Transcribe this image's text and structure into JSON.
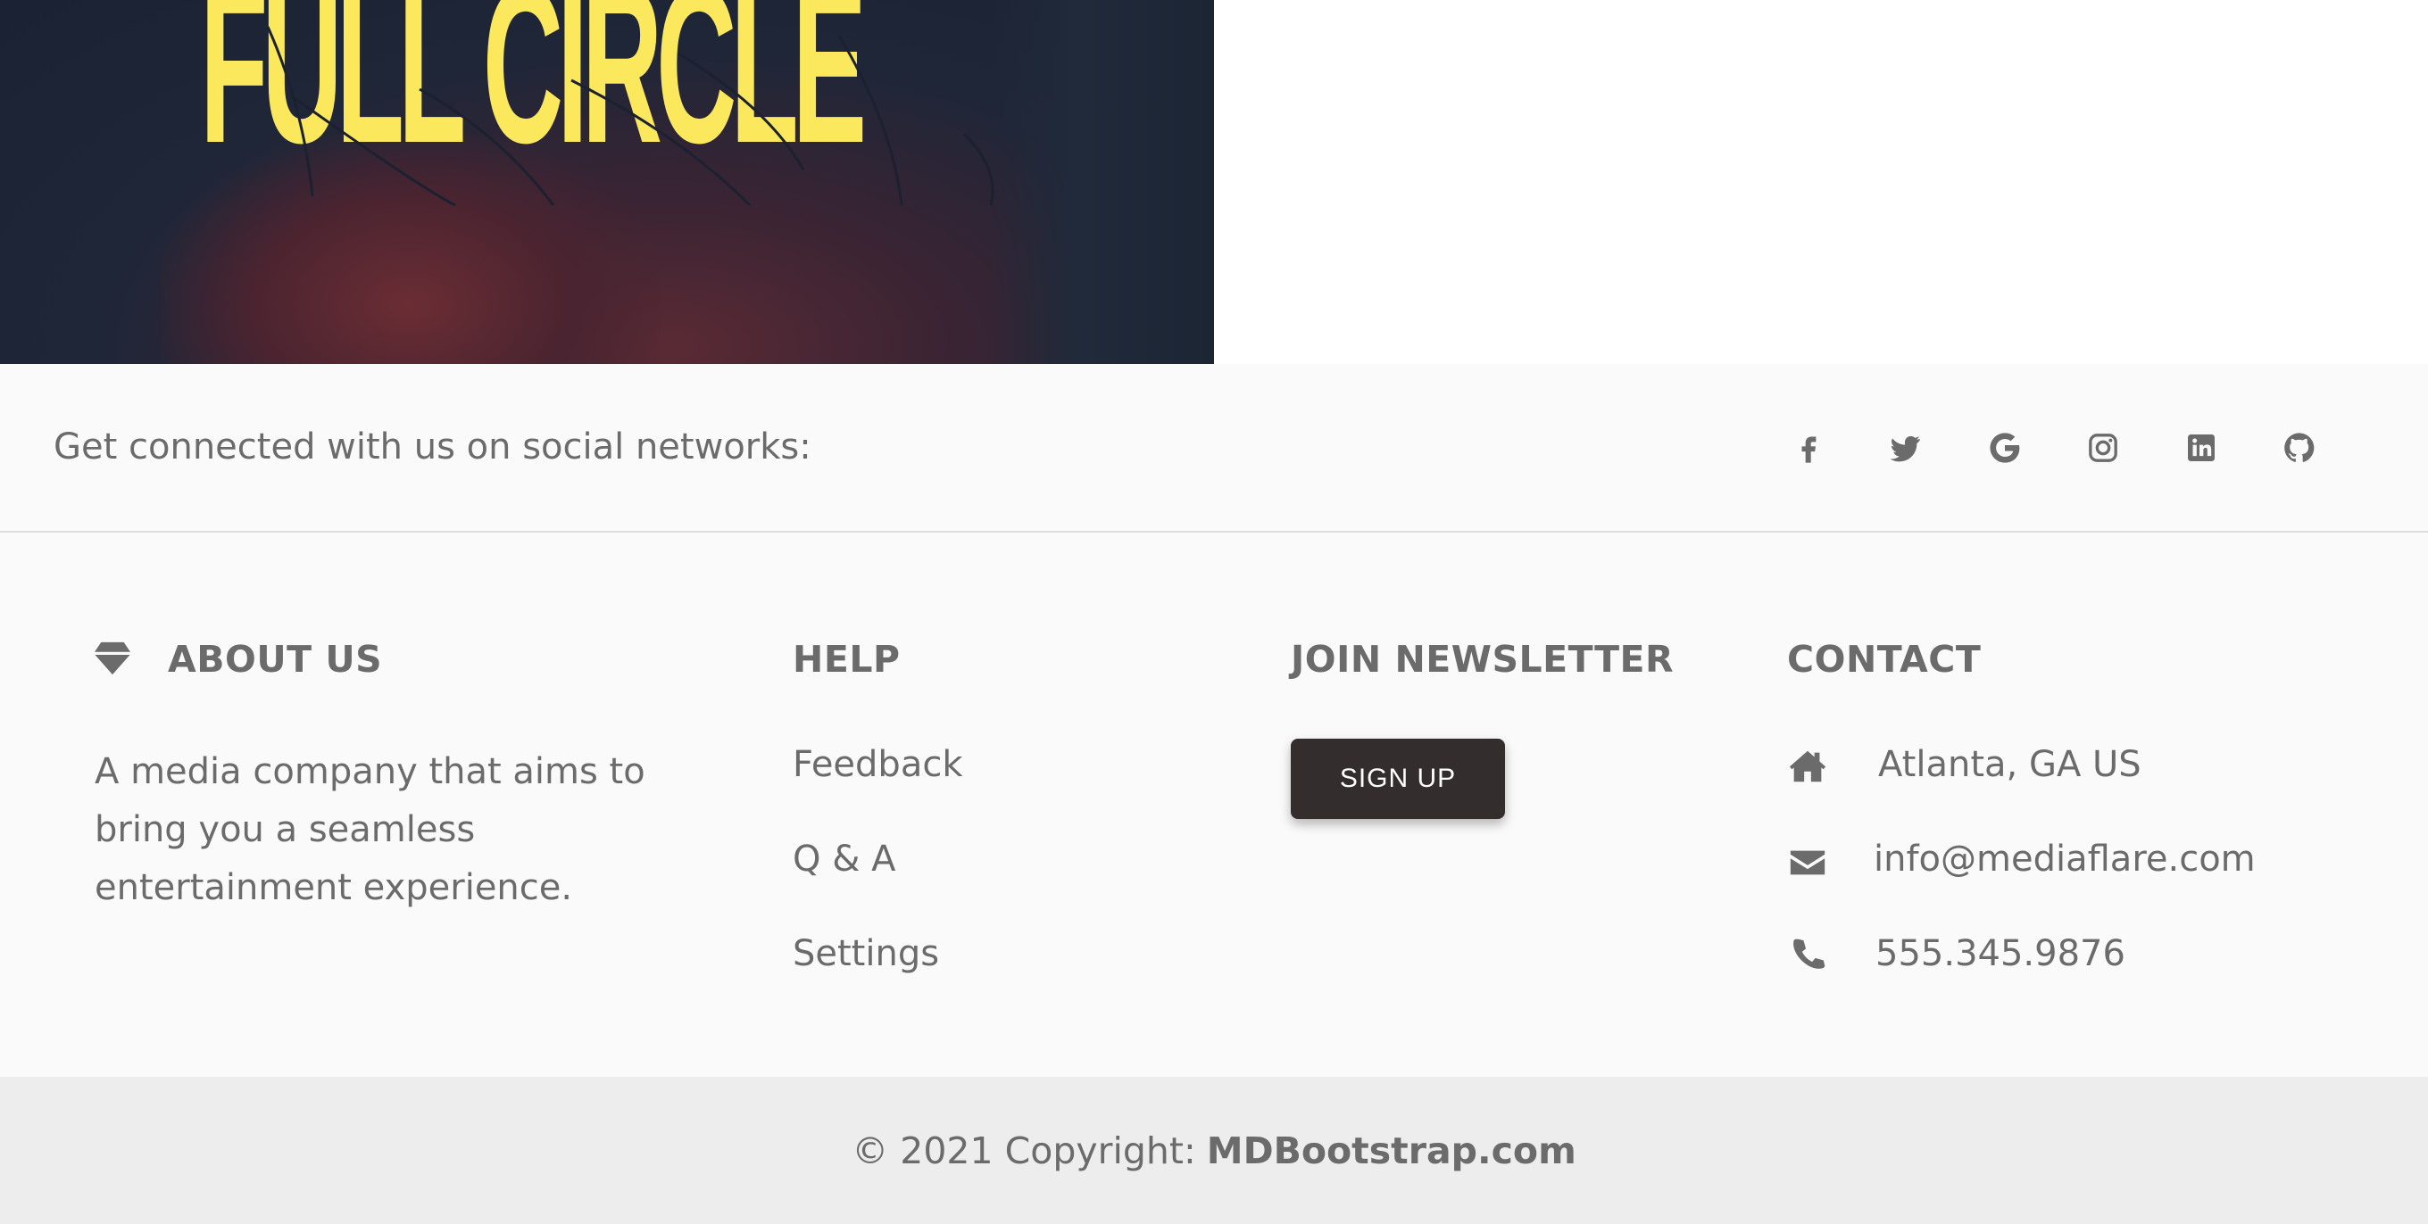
{
  "banner": {
    "title": "FULL CIRCLE",
    "title_color": "#fbe85c"
  },
  "social": {
    "text": "Get connected with us on social networks:",
    "icons": [
      "facebook-icon",
      "twitter-icon",
      "google-icon",
      "instagram-icon",
      "linkedin-icon",
      "github-icon"
    ]
  },
  "about": {
    "icon": "gem-icon",
    "title": "ABOUT US",
    "text": "A media company that aims to bring you a seamless entertainment experience."
  },
  "help": {
    "title": "HELP",
    "links": [
      "Feedback",
      "Q & A",
      "Settings"
    ]
  },
  "newsletter": {
    "title": "JOIN NEWSLETTER",
    "button_label": "SIGN UP"
  },
  "contact": {
    "title": "CONTACT",
    "items": [
      {
        "icon": "home-icon",
        "text": "Atlanta, GA US"
      },
      {
        "icon": "envelope-icon",
        "text": "info@mediaflare.com"
      },
      {
        "icon": "phone-icon",
        "text": "555.345.9876"
      }
    ]
  },
  "copyright": {
    "text": "© 2021 Copyright:",
    "link": "MDBootstrap.com"
  },
  "colors": {
    "footer_bg": "#fafafa",
    "copyright_bg": "#ededed",
    "text": "#6b6b6b",
    "button_bg": "#332d2d"
  }
}
